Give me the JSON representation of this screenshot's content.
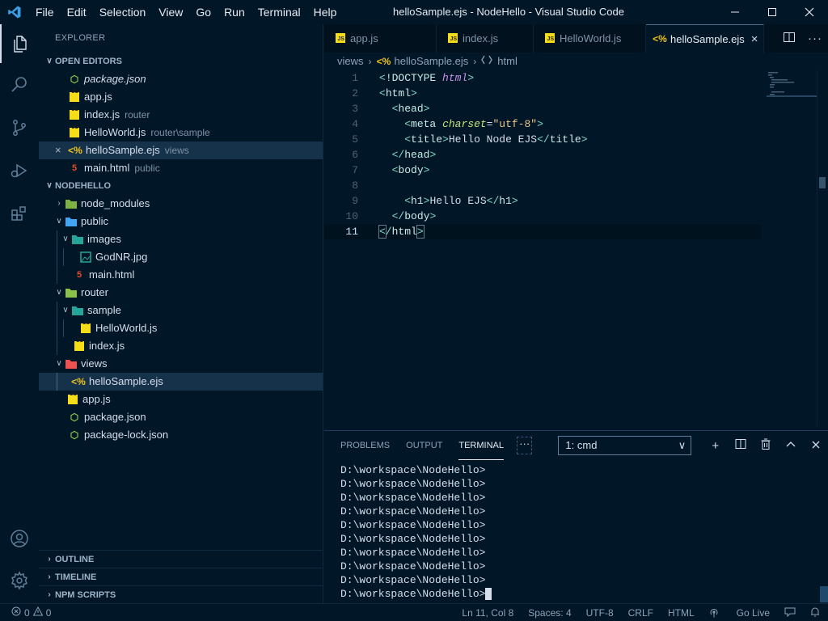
{
  "window": {
    "title": "helloSample.ejs - NodeHello - Visual Studio Code",
    "menu": [
      "File",
      "Edit",
      "Selection",
      "View",
      "Go",
      "Run",
      "Terminal",
      "Help"
    ]
  },
  "sidebar": {
    "title": "EXPLORER",
    "open_editors": {
      "heading": "OPEN EDITORS",
      "items": [
        {
          "name": "package.json",
          "desc": "",
          "icon": "json"
        },
        {
          "name": "app.js",
          "desc": "",
          "icon": "js"
        },
        {
          "name": "index.js",
          "desc": "router",
          "icon": "js"
        },
        {
          "name": "HelloWorld.js",
          "desc": "router\\sample",
          "icon": "js"
        },
        {
          "name": "helloSample.ejs",
          "desc": "views",
          "icon": "ejs"
        },
        {
          "name": "main.html",
          "desc": "public",
          "icon": "html"
        }
      ]
    },
    "project": {
      "heading": "NODEHELLO",
      "tree": [
        {
          "name": "node_modules",
          "type": "folder",
          "collapsed": true
        },
        {
          "name": "public",
          "type": "folder"
        },
        {
          "name": "images",
          "type": "folder"
        },
        {
          "name": "GodNR.jpg",
          "type": "image"
        },
        {
          "name": "main.html",
          "type": "html"
        },
        {
          "name": "router",
          "type": "folder"
        },
        {
          "name": "sample",
          "type": "folder"
        },
        {
          "name": "HelloWorld.js",
          "type": "js"
        },
        {
          "name": "index.js",
          "type": "js"
        },
        {
          "name": "views",
          "type": "folder"
        },
        {
          "name": "helloSample.ejs",
          "type": "ejs"
        },
        {
          "name": "app.js",
          "type": "js"
        },
        {
          "name": "package.json",
          "type": "json"
        },
        {
          "name": "package-lock.json",
          "type": "json"
        }
      ]
    },
    "bottom_sections": [
      "OUTLINE",
      "TIMELINE",
      "NPM SCRIPTS"
    ]
  },
  "editor": {
    "tabs": [
      {
        "label": "app.js",
        "icon": "js"
      },
      {
        "label": "index.js",
        "icon": "js"
      },
      {
        "label": "HelloWorld.js",
        "icon": "js"
      },
      {
        "label": "helloSample.ejs",
        "icon": "ejs",
        "active": true
      }
    ],
    "breadcrumb": [
      "views",
      "helloSample.ejs",
      "html"
    ],
    "line_numbers": [
      "1",
      "2",
      "3",
      "4",
      "5",
      "6",
      "7",
      "8",
      "9",
      "10",
      "11"
    ],
    "code": {
      "l1_doctype": "!DOCTYPE",
      "l1_html": "html",
      "l2_tag": "html",
      "l3_tag": "head",
      "l4_tag": "meta",
      "l4_attr": "charset",
      "l4_val": "\"utf-8\"",
      "l5_tag": "title",
      "l5_text": "Hello Node EJS",
      "l6_tag": "head",
      "l7_tag": "body",
      "l9_tag": "h1",
      "l9_text": "Hello EJS",
      "l10_tag": "body",
      "l11_tag": "html"
    }
  },
  "panel": {
    "tabs": [
      "PROBLEMS",
      "OUTPUT",
      "TERMINAL"
    ],
    "active_tab": "TERMINAL",
    "more": "···",
    "terminal_select": "1: cmd",
    "lines": [
      "D:\\workspace\\NodeHello>",
      "D:\\workspace\\NodeHello>",
      "D:\\workspace\\NodeHello>",
      "D:\\workspace\\NodeHello>",
      "D:\\workspace\\NodeHello>",
      "D:\\workspace\\NodeHello>",
      "D:\\workspace\\NodeHello>",
      "D:\\workspace\\NodeHello>",
      "D:\\workspace\\NodeHello>",
      "D:\\workspace\\NodeHello>"
    ]
  },
  "status": {
    "errors": "0",
    "warnings": "0",
    "position": "Ln 11, Col 8",
    "spaces": "Spaces: 4",
    "encoding": "UTF-8",
    "eol": "CRLF",
    "language": "HTML",
    "golive": "Go Live"
  },
  "colors": {
    "background": "#011627",
    "accent_js": "#f5de19",
    "accent_ejs": "#f0c419",
    "accent_html": "#e44d26",
    "accent_json": "#8bc34a",
    "folder_green": "#7cb342",
    "folder_blue": "#42a5f5",
    "folder_red": "#ef5350"
  }
}
